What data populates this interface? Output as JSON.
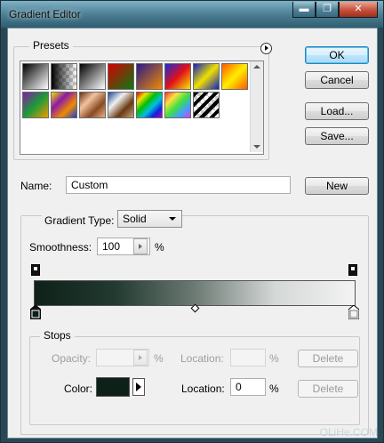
{
  "window": {
    "title": "Gradient Editor",
    "controls": {
      "minimize": "▬",
      "maximize": "❐",
      "close": "✕"
    }
  },
  "presets": {
    "legend": "Presets",
    "menu_icon": "circle-arrow-right-icon",
    "swatches": [
      {
        "name": "black-white",
        "fill": "linear-gradient(135deg,#000,#fff)"
      },
      {
        "name": "foreground-transparent",
        "fill": "linear-gradient(90deg,#000,rgba(0,0,0,0))"
      },
      {
        "name": "black-white-2",
        "fill": "linear-gradient(135deg,#000 0%,#fff 100%)"
      },
      {
        "name": "red-green",
        "fill": "linear-gradient(135deg,#d40000,#0a7a14)"
      },
      {
        "name": "violet-orange",
        "fill": "linear-gradient(135deg,#2a1a8a,#f08a00)"
      },
      {
        "name": "blue-red-yellow",
        "fill": "linear-gradient(135deg,#1a2ad8,#e0101a,#f8e800)"
      },
      {
        "name": "blue-yellow-blue",
        "fill": "linear-gradient(135deg,#1020c0,#f0e000,#1020c0)"
      },
      {
        "name": "orange-yellow-orange",
        "fill": "linear-gradient(135deg,#ff5a00,#ffee00,#ff5a00)"
      },
      {
        "name": "violet-green-orange",
        "fill": "linear-gradient(135deg,#8a1aa8,#1a9a3a,#f09a00)"
      },
      {
        "name": "yellow-violet-orange-blue",
        "fill": "linear-gradient(135deg,#f8e000,#8a1aa8,#f08a00,#1a40d0)"
      },
      {
        "name": "copper",
        "fill": "linear-gradient(135deg,#6a3012,#f2c3a0,#8a4a20,#e8b08a)"
      },
      {
        "name": "chrome",
        "fill": "linear-gradient(135deg,#1a4a9a,#f0f0f0,#6a3a10,#c0a080)"
      },
      {
        "name": "spectrum",
        "fill": "linear-gradient(135deg,#e00000,#f0e000,#00c000,#00c0e0,#1020e0,#c000c0)"
      },
      {
        "name": "transparent-rainbow",
        "fill": "linear-gradient(135deg,#ff3030,#ffe040,#40e040,#40a0ff,#e040e0)"
      },
      {
        "name": "transparent-stripes",
        "fill": "repeating-linear-gradient(135deg,#000 0 4px,rgba(255,255,255,0) 4px 8px)"
      }
    ]
  },
  "buttons": {
    "ok": "OK",
    "cancel": "Cancel",
    "load": "Load...",
    "save": "Save...",
    "new": "New"
  },
  "name_field": {
    "label": "Name:",
    "value": "Custom"
  },
  "gradient_type": {
    "label": "Gradient Type:",
    "value": "Solid"
  },
  "smoothness": {
    "label": "Smoothness:",
    "value": "100",
    "unit": "%"
  },
  "gradient": {
    "colors": [
      "#0e2118",
      "#223a30",
      "#6c7a74",
      "#d4d8d6",
      "#f3f3f3"
    ]
  },
  "stops": {
    "legend": "Stops",
    "opacity": {
      "label": "Opacity:",
      "value": "",
      "unit": "%"
    },
    "opacity_location": {
      "label": "Location:",
      "value": "",
      "unit": "%"
    },
    "color": {
      "label": "Color:",
      "swatch": "#0e2118"
    },
    "color_location": {
      "label": "Location:",
      "value": "0",
      "unit": "%"
    },
    "delete_label": "Delete"
  },
  "watermark": "OLiHe.COM"
}
